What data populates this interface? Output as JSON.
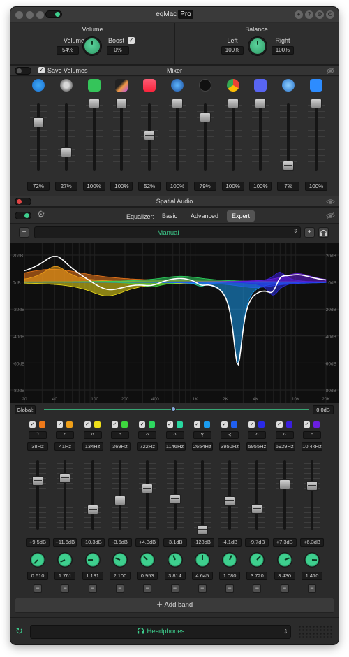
{
  "titlebar": {
    "title": "eqMac",
    "badge": "Pro"
  },
  "volume": {
    "title": "Volume",
    "volume_label": "Volume",
    "volume_value": "54%",
    "boost_label": "Boost",
    "boost_checked": true,
    "boost_value": "0%"
  },
  "balance": {
    "title": "Balance",
    "left_label": "Left",
    "left_value": "100%",
    "right_label": "Right",
    "right_value": "100%"
  },
  "mixer": {
    "save_volumes_label": "Save Volumes",
    "title": "Mixer",
    "apps": [
      {
        "icon": "safari-icon",
        "value": "72%",
        "level": 0.72
      },
      {
        "icon": "speaker-icon",
        "value": "27%",
        "level": 0.27
      },
      {
        "icon": "facetime-icon",
        "value": "100%",
        "level": 1.0
      },
      {
        "icon": "final-cut-icon",
        "value": "100%",
        "level": 1.0
      },
      {
        "icon": "music-icon",
        "value": "52%",
        "level": 0.52
      },
      {
        "icon": "quicktime-icon",
        "value": "100%",
        "level": 1.0
      },
      {
        "icon": "apple-tv-icon",
        "value": "79%",
        "level": 0.79
      },
      {
        "icon": "chrome-icon",
        "value": "100%",
        "level": 1.0
      },
      {
        "icon": "discord-icon",
        "value": "100%",
        "level": 1.0
      },
      {
        "icon": "vpn-icon",
        "value": "7%",
        "level": 0.07
      },
      {
        "icon": "zoom-icon",
        "value": "100%",
        "level": 1.0
      }
    ]
  },
  "spatial": {
    "title": "Spatial Audio"
  },
  "equalizer": {
    "label": "Equalizer:",
    "tabs": [
      "Basic",
      "Advanced",
      "Expert"
    ],
    "selected_tab": "Expert",
    "preset": "Manual",
    "graph": {
      "y_labels_left": [
        "20dB",
        "0dB",
        "-20dB",
        "-40dB",
        "-60dB",
        "-80dB"
      ],
      "y_labels_right": [
        "20dB",
        "0dB",
        "-20dB",
        "-40dB",
        "-60dB",
        "-80dB"
      ],
      "x_labels": [
        "20",
        "40",
        "100",
        "200",
        "400",
        "1K",
        "2K",
        "4K",
        "10K",
        "20K"
      ]
    },
    "global_label": "Global:",
    "global_value": "0.0dB",
    "bands": [
      {
        "color": "#f07a1a",
        "type": "⌝",
        "freq": "38Hz",
        "gain": "+9.5dB",
        "gain_db": 9.5,
        "q": "0.610"
      },
      {
        "color": "#f0a019",
        "type": "^",
        "freq": "41Hz",
        "gain": "+11.6dB",
        "gain_db": 11.6,
        "q": "1.761"
      },
      {
        "color": "#f0e01a",
        "type": "^",
        "freq": "134Hz",
        "gain": "-10.3dB",
        "gain_db": -10.3,
        "q": "1.131"
      },
      {
        "color": "#3ed83e",
        "type": "^",
        "freq": "369Hz",
        "gain": "-3.6dB",
        "gain_db": -3.6,
        "q": "2.100"
      },
      {
        "color": "#2ed860",
        "type": "^",
        "freq": "722Hz",
        "gain": "+4.3dB",
        "gain_db": 4.3,
        "q": "0.953"
      },
      {
        "color": "#28d8a0",
        "type": "^",
        "freq": "1146Hz",
        "gain": "-3.1dB",
        "gain_db": -3.1,
        "q": "3.814"
      },
      {
        "color": "#1a9cf0",
        "type": "Y",
        "freq": "2654Hz",
        "gain": "-128dB",
        "gain_db": -128,
        "q": "4.645"
      },
      {
        "color": "#2060f0",
        "type": "<",
        "freq": "3950Hz",
        "gain": "-4.1dB",
        "gain_db": -4.1,
        "q": "1.080"
      },
      {
        "color": "#2a2ae8",
        "type": "^",
        "freq": "5955Hz",
        "gain": "-9.7dB",
        "gain_db": -9.7,
        "q": "3.720"
      },
      {
        "color": "#3a1ee0",
        "type": "^",
        "freq": "6929Hz",
        "gain": "+7.3dB",
        "gain_db": 7.3,
        "q": "3.430"
      },
      {
        "color": "#6a1ee0",
        "type": "^",
        "freq": "10.4kHz",
        "gain": "+6.3dB",
        "gain_db": 6.3,
        "q": "1.410"
      }
    ],
    "add_band_label": "Add band"
  },
  "output": {
    "device": "Headphones"
  }
}
